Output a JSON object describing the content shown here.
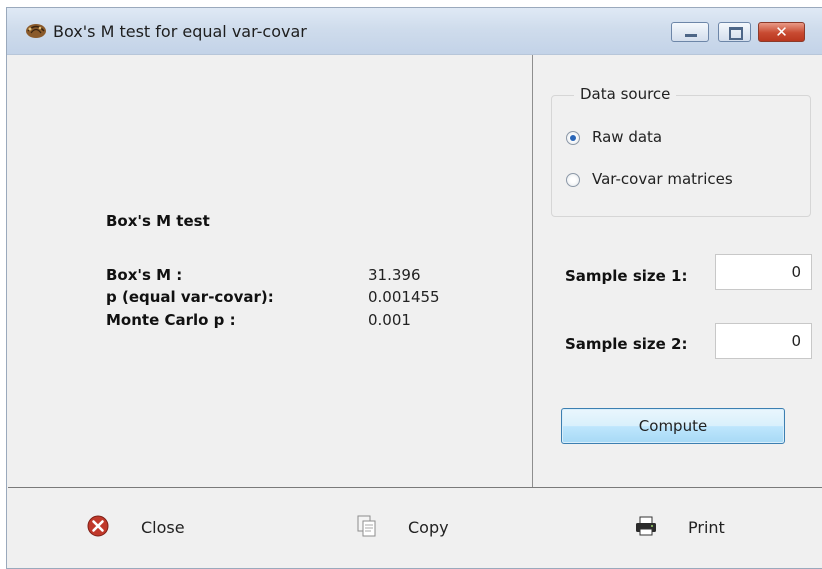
{
  "window": {
    "title": "Box's M test for equal var-covar",
    "icon": "shell-icon",
    "controls": {
      "minimize": "minimize-icon",
      "maximize": "maximize-icon",
      "close": "✕"
    }
  },
  "results": {
    "heading": "Box's  M  test",
    "rows": [
      {
        "label": "Box's  M :",
        "value": "31.396"
      },
      {
        "label": "p   (equal  var-covar):",
        "value": "0.001455"
      },
      {
        "label": "Monte  Carlo  p :",
        "value": "0.001"
      }
    ]
  },
  "data_source": {
    "legend": "Data source",
    "options": [
      {
        "label": "Raw data",
        "selected": true
      },
      {
        "label": "Var-covar matrices",
        "selected": false
      }
    ]
  },
  "inputs": {
    "sample_size_1": {
      "label": "Sample size 1:",
      "value": "0"
    },
    "sample_size_2": {
      "label": "Sample size 2:",
      "value": "0"
    }
  },
  "compute_label": "Compute",
  "footer": {
    "close": {
      "label": "Close",
      "icon": "close-circle-icon"
    },
    "copy": {
      "label": "Copy",
      "icon": "copy-icon"
    },
    "print": {
      "label": "Print",
      "icon": "printer-icon"
    }
  },
  "colors": {
    "titlebar": "#cfdcec",
    "close_button": "#c84a31",
    "compute_border": "#3c7fb1",
    "radio_checked": "#2a66b8"
  }
}
